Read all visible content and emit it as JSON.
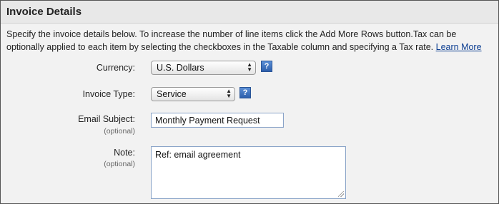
{
  "panel": {
    "title": "Invoice Details",
    "description": "Specify the invoice details below. To increase the number of line items click the Add More Rows button.Tax can be optionally applied to  each item by selecting the checkboxes in the Taxable column and specifying a Tax rate.",
    "learn_more": "Learn More"
  },
  "form": {
    "currency": {
      "label": "Currency:",
      "value": "U.S. Dollars"
    },
    "invoice_type": {
      "label": "Invoice Type:",
      "value": "Service"
    },
    "email_subject": {
      "label": "Email Subject:",
      "sublabel": "(optional)",
      "value": "Monthly Payment Request"
    },
    "note": {
      "label": "Note:",
      "sublabel": "(optional)",
      "value": "Ref: email agreement"
    },
    "help_glyph": "?"
  },
  "icons": {
    "help": "question-mark-icon",
    "select_arrows": "up-down-chevron-icon",
    "resize": "resize-grip-icon"
  },
  "colors": {
    "link": "#0b3d91",
    "help_icon": "#3b6fc0",
    "panel_bg": "#f2f2f2"
  }
}
